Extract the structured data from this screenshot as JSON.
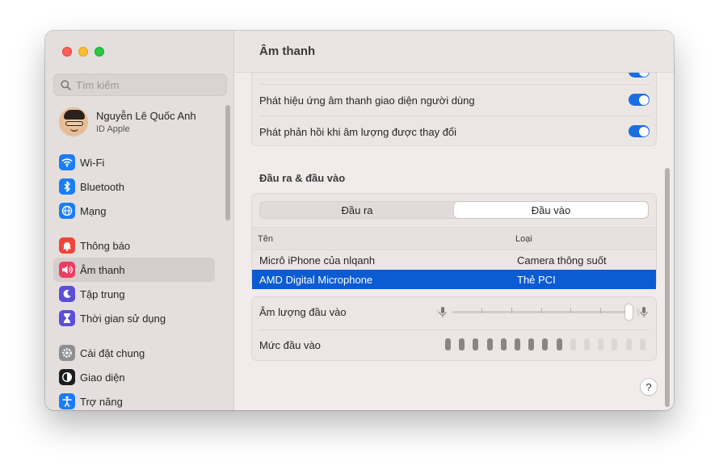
{
  "window": {
    "title": "Âm thanh"
  },
  "sidebar": {
    "search_placeholder": "Tìm kiếm",
    "profile": {
      "name": "Nguyễn Lê Quốc Anh",
      "subtitle": "ID Apple"
    },
    "groups": [
      [
        {
          "label": "Wi-Fi",
          "icon": "wifi-icon",
          "color": "#1b7cf5"
        },
        {
          "label": "Bluetooth",
          "icon": "bluetooth-icon",
          "color": "#1b7cf5"
        },
        {
          "label": "Mạng",
          "icon": "globe-icon",
          "color": "#1b7cf5"
        }
      ],
      [
        {
          "label": "Thông báo",
          "icon": "bell-icon",
          "color": "#f0453a"
        },
        {
          "label": "Âm thanh",
          "icon": "speaker-icon",
          "color": "#ef3c61",
          "active": true
        },
        {
          "label": "Tập trung",
          "icon": "moon-icon",
          "color": "#5b4fd8"
        },
        {
          "label": "Thời gian sử dụng",
          "icon": "hourglass-icon",
          "color": "#5b4fd8"
        }
      ],
      [
        {
          "label": "Cài đặt chung",
          "icon": "gear-icon",
          "color": "#8e8e93"
        },
        {
          "label": "Giao diện",
          "icon": "appearance-icon",
          "color": "#1d1d1f"
        },
        {
          "label": "Trợ năng",
          "icon": "accessibility-icon",
          "color": "#1b7cf5"
        }
      ]
    ]
  },
  "main": {
    "top_settings": [
      {
        "label": "Phát hiệu ứng âm thanh giao diện người dùng",
        "enabled": true
      },
      {
        "label": "Phát phản hồi khi âm lượng được thay đổi",
        "enabled": true
      }
    ],
    "io_section": {
      "title": "Đầu ra & đầu vào",
      "tabs": [
        "Đầu ra",
        "Đầu vào"
      ],
      "selected_tab": "Đầu vào",
      "columns": [
        "Tên",
        "Loại"
      ],
      "devices": [
        {
          "name": "Micrô iPhone của nlqanh",
          "type": "Camera thông suốt",
          "selected": false
        },
        {
          "name": "AMD Digital Microphone",
          "type": "Thẻ PCI",
          "selected": true
        }
      ]
    },
    "input_volume": {
      "label": "Âm lượng đầu vào",
      "value": 1.0
    },
    "input_level": {
      "label": "Mức đầu vào",
      "segments_total": 15,
      "segments_active": 9
    },
    "help_label": "?"
  },
  "colors": {
    "accent": "#0b5bd3",
    "toggle_on": "#1a6fe0"
  }
}
